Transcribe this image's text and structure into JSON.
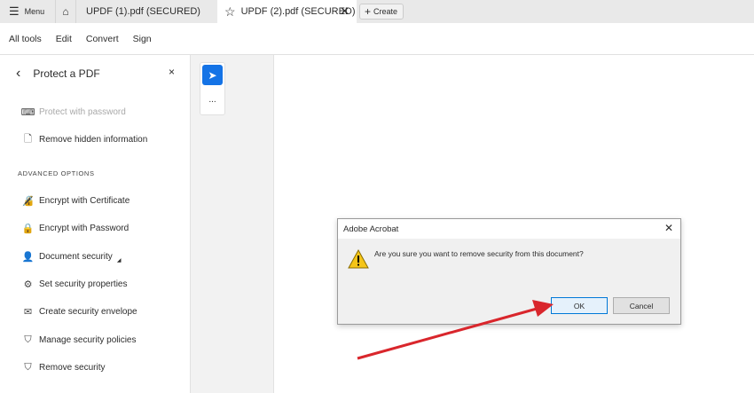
{
  "tabbar": {
    "menu": "Menu",
    "tabs": [
      {
        "label": "UPDF (1).pdf (SECURED)"
      },
      {
        "label": "UPDF (2).pdf (SECURED)"
      }
    ],
    "create": "Create"
  },
  "toolbar": {
    "items": [
      "All tools",
      "Edit",
      "Convert",
      "Sign"
    ]
  },
  "sidebar": {
    "title": "Protect a PDF",
    "items": [
      {
        "label": "Protect with password"
      },
      {
        "label": "Remove hidden information"
      }
    ],
    "heading": "ADVANCED OPTIONS",
    "advanced": [
      {
        "label": "Encrypt with Certificate"
      },
      {
        "label": "Encrypt with Password"
      },
      {
        "label": "Document security"
      },
      {
        "label": "Set security properties"
      },
      {
        "label": "Create security envelope"
      },
      {
        "label": "Manage security policies"
      },
      {
        "label": "Remove security"
      }
    ]
  },
  "tools": {
    "more": "..."
  },
  "dialog": {
    "title": "Adobe Acrobat",
    "message": "Are you sure you want to remove security from this document?",
    "ok": "OK",
    "cancel": "Cancel"
  },
  "colors": {
    "accent": "#1473e6",
    "arrow": "#d9262c"
  }
}
